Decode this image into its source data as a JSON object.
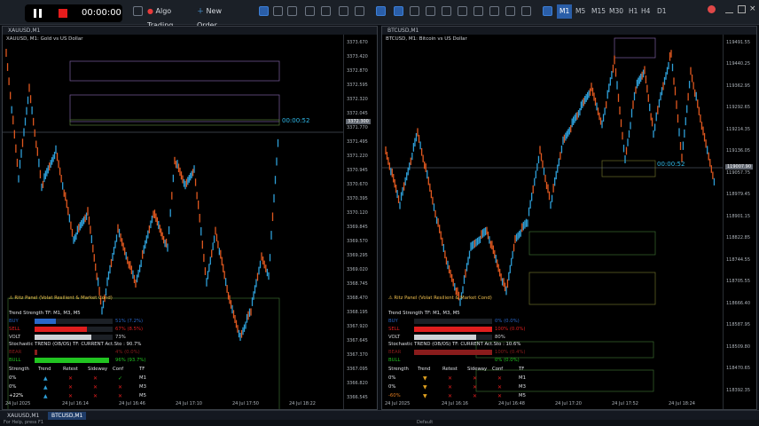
{
  "recorder": {
    "time": "00:00:00"
  },
  "toolbar": {
    "algo_trading": "Algo Trading",
    "new_order": "New Order",
    "timeframes": [
      "M1",
      "M5",
      "M15",
      "M30",
      "H1",
      "H4",
      "D1"
    ],
    "active_tf": "M1"
  },
  "left": {
    "symbol": "XAUUSD, M1:  Gold vs US Dollar",
    "caption": "XAUUSD,M1",
    "timer": "00:00:52",
    "price_tag": "3372.300",
    "prices": [
      "3373.670",
      "3373.420",
      "3372.870",
      "3372.595",
      "3372.320",
      "3372.045",
      "3371.770",
      "3371.495",
      "3371.220",
      "3370.945",
      "3370.670",
      "3370.395",
      "3370.120",
      "3369.845",
      "3369.570",
      "3369.295",
      "3369.020",
      "3368.745",
      "3368.470",
      "3368.195",
      "3367.920",
      "3367.645",
      "3367.370",
      "3367.095",
      "3366.820",
      "3366.545"
    ],
    "times": [
      "24 Jul 2025",
      "24 Jul 16:14",
      "24 Jul 16:46",
      "24 Jul 17:10",
      "24 Jul 17:50",
      "24 Jul 18:22"
    ]
  },
  "right": {
    "symbol": "BTCUSD, M1:  Bitcoin vs US Dollar",
    "caption": "BTCUSD,M1",
    "timer": "00:00:52",
    "price_tag": "119007.90",
    "prices": [
      "119491.55",
      "119440.25",
      "119362.95",
      "119292.65",
      "119214.35",
      "119136.05",
      "119057.75",
      "118979.45",
      "118901.15",
      "118822.85",
      "118744.55",
      "118705.55",
      "118666.40",
      "118587.95",
      "118509.80",
      "118470.65",
      "118392.35"
    ],
    "times": [
      "24 Jul 2025",
      "24 Jul 16:16",
      "24 Jul 16:48",
      "24 Jul 17:20",
      "24 Jul 17:52",
      "24 Jul 18:24"
    ]
  },
  "panel_left": {
    "title": "Ritz Panel (Volat Resilient & Market Cond)",
    "strength_tf": "Trend Strength TF: M1, M3, M5",
    "buy": "BUY",
    "buy_val": "51% (7.2%)",
    "buy_pct": 0.27,
    "sell": "SELL",
    "sell_val": "67% (8.5%)",
    "sell_pct": 0.67,
    "volt": "VOLT",
    "volt_val": "73%",
    "volt_pct": 0.73,
    "stoch": "Stochastic TREND (OB/OS) TF: CURRENT Act.Sto : 90.7%",
    "bear": "BEAR",
    "bear_val": "4% (0.0%)",
    "bear_pct": 0.03,
    "bull": "BULL",
    "bull_val": "96% (93.7%)",
    "bull_pct": 0.96,
    "headers": [
      "Strength",
      "Trend",
      "Retest",
      "Sideway",
      "Conf",
      "TF"
    ],
    "rows": [
      {
        "strength": "0%",
        "trend": "▲",
        "retest": "✕",
        "sideway": "✕",
        "conf": "✓",
        "tf": "M1"
      },
      {
        "strength": "0%",
        "trend": "▲",
        "retest": "✕",
        "sideway": "✕",
        "conf": "✕",
        "tf": "M3"
      },
      {
        "strength": "+22%",
        "trend": "▲",
        "retest": "✕",
        "sideway": "✕",
        "conf": "✕",
        "tf": "M5"
      }
    ]
  },
  "panel_right": {
    "title": "Ritz Panel (Volat Resilient & Market Cond)",
    "strength_tf": "Trend Strength TF: M1, M3, M5",
    "buy": "BUY",
    "buy_val": "0% (0.0%)",
    "buy_pct": 0.0,
    "sell": "SELL",
    "sell_val": "100% (0.0%)",
    "sell_pct": 1.0,
    "volt": "VOLT",
    "volt_val": "80%",
    "volt_pct": 0.8,
    "stoch": "Stochastic TREND (OB/OS) TF: CURRENT Act.Sto : 10.6%",
    "bear": "BEAR",
    "bear_val": "100% (0.4%)",
    "bear_pct": 1.0,
    "bull": "BULL",
    "bull_val": "0% (0.0%)",
    "bull_pct": 0.0,
    "headers": [
      "Strength",
      "Trend",
      "Retest",
      "Sideway",
      "Conf",
      "TF"
    ],
    "rows": [
      {
        "strength": "0%",
        "trend": "▼",
        "retest": "✕",
        "sideway": "✕",
        "conf": "✕",
        "tf": "M1"
      },
      {
        "strength": "0%",
        "trend": "▼",
        "retest": "✕",
        "sideway": "✕",
        "conf": "✕",
        "tf": "M3"
      },
      {
        "strength": "-60%",
        "trend": "▼",
        "retest": "✕",
        "sideway": "✕",
        "conf": "✕",
        "tf": "M5"
      }
    ]
  },
  "tabs": [
    "XAUUSD,M1",
    "BTCUSD,M1"
  ],
  "status": {
    "left": "For Help, press F1",
    "mid": "Default"
  },
  "colors": {
    "up": "#2e9fd8",
    "down": "#e0581f",
    "buy": "#2a67c8",
    "sell": "#e01e1e",
    "volt": "#cfd2d6",
    "bull": "#21c421",
    "bear": "#8a1c1c"
  }
}
